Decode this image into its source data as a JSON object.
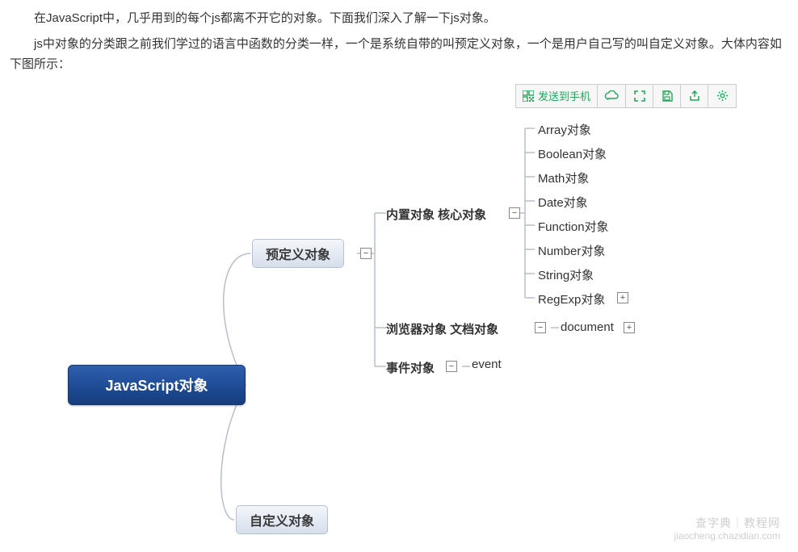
{
  "intro": {
    "p1": "在JavaScript中，几乎用到的每个js都离不开它的对象。下面我们深入了解一下js对象。",
    "p2": "js中对象的分类跟之前我们学过的语言中函数的分类一样，一个是系统自带的叫预定义对象，一个是用户自己写的叫自定义对象。大体内容如下图所示："
  },
  "toolbar": {
    "send_label": "发送到手机",
    "icons": {
      "qr": "qr-icon",
      "cloud": "cloud-icon",
      "full": "fullscreen-icon",
      "save": "save-icon",
      "share": "share-icon",
      "gear": "gear-icon"
    }
  },
  "root": {
    "label": "JavaScript对象"
  },
  "predefined": {
    "label": "预定义对象",
    "builtin": {
      "label": "内置对象  核心对象",
      "items": [
        "Array对象",
        "Boolean对象",
        "Math对象",
        "Date对象",
        "Function对象",
        "Number对象",
        "String对象",
        "RegExp对象"
      ]
    },
    "browser": {
      "label": "浏览器对象  文档对象",
      "item": "document"
    },
    "event": {
      "label": "事件对象",
      "item": "event"
    }
  },
  "custom": {
    "label": "自定义对象"
  },
  "toggles": {
    "minus": "−",
    "plus": "+"
  },
  "watermark": {
    "line1": "查字典｜教程网",
    "line2": "jiaocheng.chazidian.com"
  }
}
